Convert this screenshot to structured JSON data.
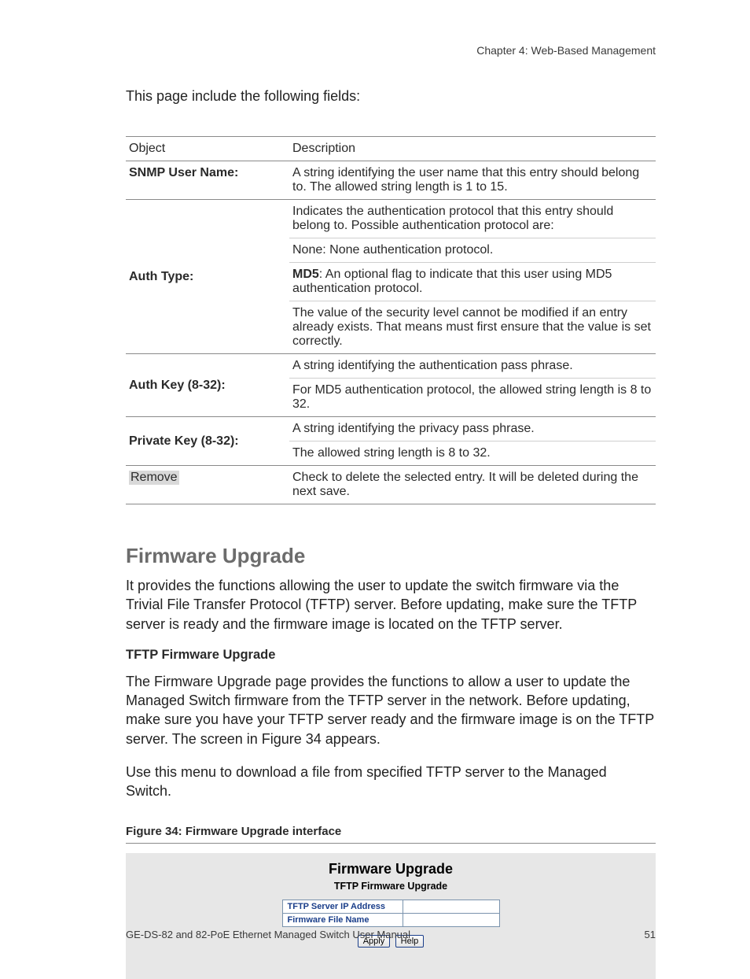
{
  "header": {
    "chapter": "Chapter 4: Web-Based Management"
  },
  "intro": "This page include the following fields:",
  "columns": {
    "object": "Object",
    "description": "Description"
  },
  "rows": [
    {
      "object": "SNMP User Name:",
      "object_bold": true,
      "paragraphs": [
        "A string identifying the user name that this entry should belong to. The allowed string length is 1 to 15."
      ]
    },
    {
      "object": "Auth Type:",
      "object_bold": true,
      "paragraphs": [
        "Indicates the authentication protocol that this entry should belong to. Possible authentication protocol are:",
        "None: None authentication protocol.",
        "MD5: An optional flag to indicate that this user using MD5 authentication protocol.",
        "The value of the security level cannot be modified if an entry already exists. That means must first ensure that the value is set correctly."
      ],
      "bold_prefix_index": 2,
      "bold_prefix_text": "MD5"
    },
    {
      "object": "Auth Key (8-32):",
      "object_bold": true,
      "paragraphs": [
        "A string identifying the authentication pass phrase.",
        "For MD5 authentication protocol, the allowed string length is 8 to 32."
      ]
    },
    {
      "object": "Private Key (8-32):",
      "object_bold": true,
      "paragraphs": [
        "A string identifying the privacy pass phrase.",
        "The allowed string length is 8 to 32."
      ]
    },
    {
      "object": "Remove",
      "object_bold": false,
      "object_shaded": true,
      "paragraphs": [
        "Check to delete the selected entry. It will be deleted during the next save."
      ]
    }
  ],
  "section": {
    "title": "Firmware Upgrade",
    "para1": "It provides the functions allowing the user to update the switch firmware via the Trivial File Transfer Protocol (TFTP) server. Before updating, make sure the TFTP server is ready and the firmware image is located on the TFTP server.",
    "subheading": "TFTP Firmware Upgrade",
    "para2": "The Firmware Upgrade page provides the functions to allow a user to update the Managed Switch firmware from the TFTP server in the network. Before updating, make sure you have your TFTP server ready and the firmware image is on the TFTP server. The screen in Figure 34 appears.",
    "para3": "Use this menu to download a file from specified TFTP server to the Managed Switch."
  },
  "figure": {
    "caption": "Figure 34:  Firmware Upgrade interface",
    "panel_title": "Firmware Upgrade",
    "panel_subtitle": "TFTP Firmware Upgrade",
    "field1": "TFTP Server IP Address",
    "field2": "Firmware File Name",
    "btn_apply": "Apply",
    "btn_help": "Help"
  },
  "footer": {
    "left": "GE-DS-82 and 82-PoE Ethernet Managed Switch User Manual",
    "right": "51"
  }
}
